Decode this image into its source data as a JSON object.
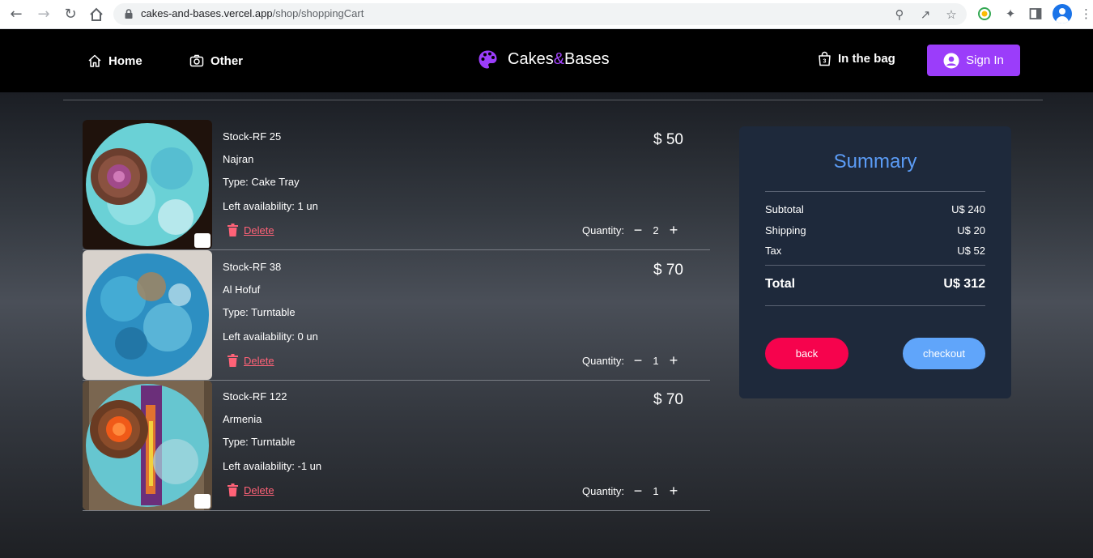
{
  "browser": {
    "url_host": "cakes-and-bases.vercel.app",
    "url_path": "/shop/shoppingCart"
  },
  "header": {
    "home_label": "Home",
    "other_label": "Other",
    "brand_part1": "Cakes",
    "brand_amp": "&",
    "brand_part2": "Bases",
    "bag_label": "In the bag",
    "signin_label": "Sign In"
  },
  "cart": {
    "delete_label": "Delete",
    "quantity_label": "Quantity:",
    "items": [
      {
        "stock": "Stock-RF 25",
        "name": "Najran",
        "type": "Type: Cake Tray",
        "availability": "Left availability: 1 un",
        "price": "$ 50",
        "quantity": "2"
      },
      {
        "stock": "Stock-RF 38",
        "name": "Al Hofuf",
        "type": "Type: Turntable",
        "availability": "Left availability: 0 un",
        "price": "$ 70",
        "quantity": "1"
      },
      {
        "stock": "Stock-RF 122",
        "name": "Armenia",
        "type": "Type: Turntable",
        "availability": "Left availability: -1 un",
        "price": "$ 70",
        "quantity": "1"
      }
    ]
  },
  "summary": {
    "title": "Summary",
    "subtotal_label": "Subtotal",
    "subtotal_value": "U$ 240",
    "shipping_label": "Shipping",
    "shipping_value": "U$ 20",
    "tax_label": "Tax",
    "tax_value": "U$ 52",
    "total_label": "Total",
    "total_value": "U$ 312",
    "back_label": "back",
    "checkout_label": "checkout"
  },
  "colors": {
    "accent_purple": "#9b3dfa",
    "summary_title": "#5b9cf6",
    "delete_red": "#ff6277",
    "back_button": "#f6034d",
    "checkout_button": "#60a5fa"
  }
}
